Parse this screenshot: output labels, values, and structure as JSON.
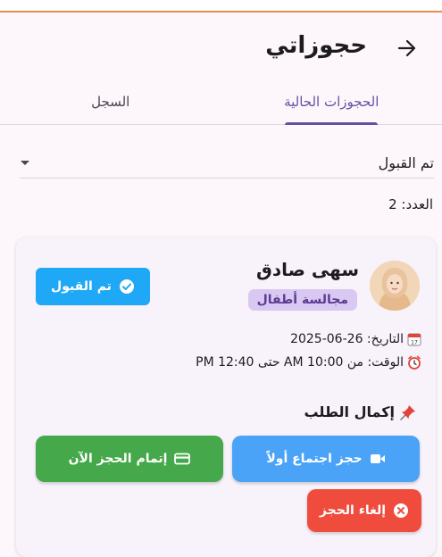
{
  "header": {
    "title": "حجوزاتي"
  },
  "tabs": [
    {
      "label": "الحجوزات الحالية",
      "active": true
    },
    {
      "label": "السجل",
      "active": false
    }
  ],
  "filter": {
    "selected": "تم القبول"
  },
  "count_label": "العدد: 2",
  "booking": {
    "provider_name": "سهى صادق",
    "service": "مجالسة أطفال",
    "status": "تم القبول",
    "date_line": "التاريخ: 26-06-2025",
    "time_line": "الوقت: من 10:00 AM حتى 12:40 PM",
    "section_title": "إكمال الطلب",
    "meeting_button": "حجز اجتماع أولاً",
    "complete_button": "إتمام الحجز الآن",
    "cancel_button": "إلغاء الحجز"
  },
  "colors": {
    "primary": "#6750a4",
    "status_blue": "#1fa8f5",
    "meeting_blue": "#4aa3f7",
    "complete_green": "#45a84a",
    "cancel_red": "#ef4c3e",
    "badge_lavender": "#d9c8f1"
  }
}
